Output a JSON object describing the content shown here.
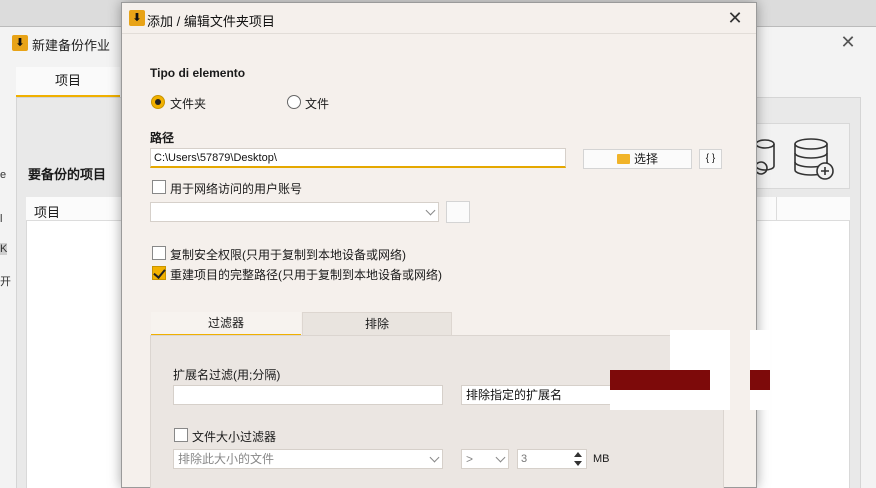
{
  "background_window": {
    "title": "新建备份作业",
    "tab_items": "项目",
    "section_title": "要备份的项目",
    "column_item": "项目",
    "left_fragments": [
      "e",
      "l",
      "K",
      "开"
    ]
  },
  "dialog": {
    "title": "添加 / 编辑文件夹项目",
    "element_type_label": "Tipo di elemento",
    "radio_folder": "文件夹",
    "radio_file": "文件",
    "path_label": "路径",
    "path_value": "C:\\Users\\57879\\Desktop\\",
    "choose_button": "选择",
    "var_button": "{ }",
    "network_account_label": "用于网络访问的用户账号",
    "copy_security_label": "复制安全权限(只用于复制到本地设备或网络)",
    "rebuild_path_label": "重建项目的完整路径(只用于复制到本地设备或网络)",
    "tabs": [
      "过滤器",
      "排除"
    ],
    "ext_filter_label": "扩展名过滤(用;分隔)",
    "ext_mode_value": "排除指定的扩展名",
    "size_filter_label": "文件大小过滤器",
    "size_mode_value": "排除此大小的文件",
    "compare_op": ">",
    "size_value": "3",
    "size_unit": "MB"
  },
  "state": {
    "radio_folder_selected": true,
    "network_account_checked": false,
    "copy_security_checked": false,
    "rebuild_path_checked": true,
    "size_filter_checked": false,
    "active_tab": 0
  },
  "colors": {
    "accent": "#f2b100",
    "dialog_bg": "#f5f0ec",
    "redaction": "#7d0a0a"
  },
  "icons": {
    "app_logo": "download-arrow-icon",
    "close": "close-icon",
    "folder": "folder-icon",
    "database": "database-add-icon"
  }
}
